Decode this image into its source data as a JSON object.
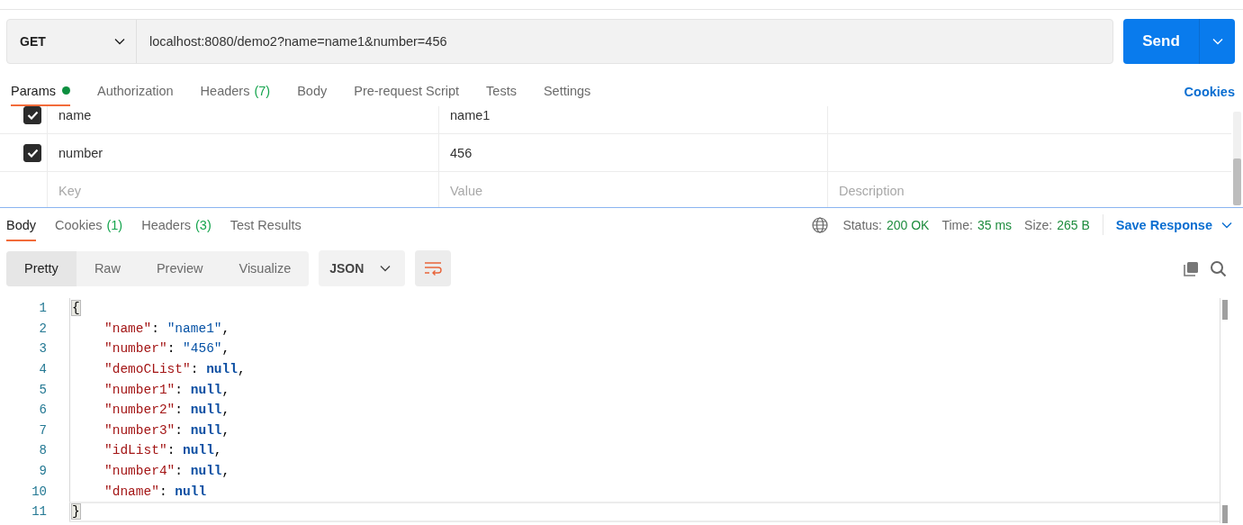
{
  "request": {
    "method": "GET",
    "url": "localhost:8080/demo2?name=name1&number=456",
    "send": "Send"
  },
  "request_tabs": [
    {
      "label": "Params",
      "indicator": true,
      "selected": true
    },
    {
      "label": "Authorization",
      "indicator": false,
      "selected": false
    },
    {
      "label": "Headers",
      "count": "(7)",
      "indicator": false,
      "selected": false
    },
    {
      "label": "Body",
      "indicator": false,
      "selected": false
    },
    {
      "label": "Pre-request Script",
      "indicator": false,
      "selected": false
    },
    {
      "label": "Tests",
      "indicator": false,
      "selected": false
    },
    {
      "label": "Settings",
      "indicator": false,
      "selected": false
    }
  ],
  "cookies_link": "Cookies",
  "params": {
    "rows": [
      {
        "key": "name",
        "value": "name1",
        "checked": true
      },
      {
        "key": "number",
        "value": "456",
        "checked": true
      }
    ],
    "new_row": {
      "key_placeholder": "Key",
      "value_placeholder": "Value",
      "description_placeholder": "Description"
    }
  },
  "response_tabs": [
    {
      "label": "Body",
      "selected": true
    },
    {
      "label": "Cookies",
      "count": "(1)",
      "selected": false
    },
    {
      "label": "Headers",
      "count": "(3)",
      "selected": false
    },
    {
      "label": "Test Results",
      "selected": false
    }
  ],
  "response_meta": [
    {
      "label": "Status:",
      "value": "200 OK"
    },
    {
      "label": "Time:",
      "value": "35 ms"
    },
    {
      "label": "Size:",
      "value": "265 B"
    }
  ],
  "save_response": "Save Response",
  "view_modes": [
    {
      "label": "Pretty",
      "selected": true
    },
    {
      "label": "Raw",
      "selected": false
    },
    {
      "label": "Preview",
      "selected": false
    },
    {
      "label": "Visualize",
      "selected": false
    }
  ],
  "format": "JSON",
  "wrap_on": true,
  "code_lines": [
    {
      "number": "1",
      "current": false,
      "tokens": [
        {
          "kind": "brace",
          "text": "{"
        }
      ],
      "children": [
        {
          "number": "2",
          "current": false,
          "tokens": [
            {
              "kind": "key",
              "text": "\"name\""
            },
            {
              "kind": "punct",
              "text": ": "
            },
            {
              "kind": "string",
              "text": "\"name1\""
            },
            {
              "kind": "punct",
              "text": ","
            }
          ]
        },
        {
          "number": "3",
          "current": false,
          "tokens": [
            {
              "kind": "key",
              "text": "\"number\""
            },
            {
              "kind": "punct",
              "text": ": "
            },
            {
              "kind": "string",
              "text": "\"456\""
            },
            {
              "kind": "punct",
              "text": ","
            }
          ]
        },
        {
          "number": "4",
          "current": false,
          "tokens": [
            {
              "kind": "key",
              "text": "\"demoCList\""
            },
            {
              "kind": "punct",
              "text": ": "
            },
            {
              "kind": "null",
              "text": "null"
            },
            {
              "kind": "punct",
              "text": ","
            }
          ]
        },
        {
          "number": "5",
          "current": false,
          "tokens": [
            {
              "kind": "key",
              "text": "\"number1\""
            },
            {
              "kind": "punct",
              "text": ": "
            },
            {
              "kind": "null",
              "text": "null"
            },
            {
              "kind": "punct",
              "text": ","
            }
          ]
        },
        {
          "number": "6",
          "current": false,
          "tokens": [
            {
              "kind": "key",
              "text": "\"number2\""
            },
            {
              "kind": "punct",
              "text": ": "
            },
            {
              "kind": "null",
              "text": "null"
            },
            {
              "kind": "punct",
              "text": ","
            }
          ]
        },
        {
          "number": "7",
          "current": false,
          "tokens": [
            {
              "kind": "key",
              "text": "\"number3\""
            },
            {
              "kind": "punct",
              "text": ": "
            },
            {
              "kind": "null",
              "text": "null"
            },
            {
              "kind": "punct",
              "text": ","
            }
          ]
        },
        {
          "number": "8",
          "current": false,
          "tokens": [
            {
              "kind": "key",
              "text": "\"idList\""
            },
            {
              "kind": "punct",
              "text": ": "
            },
            {
              "kind": "null",
              "text": "null"
            },
            {
              "kind": "punct",
              "text": ","
            }
          ]
        },
        {
          "number": "9",
          "current": false,
          "tokens": [
            {
              "kind": "key",
              "text": "\"number4\""
            },
            {
              "kind": "punct",
              "text": ": "
            },
            {
              "kind": "null",
              "text": "null"
            },
            {
              "kind": "punct",
              "text": ","
            }
          ]
        },
        {
          "number": "10",
          "current": false,
          "tokens": [
            {
              "kind": "key",
              "text": "\"dname\""
            },
            {
              "kind": "punct",
              "text": ": "
            },
            {
              "kind": "null",
              "text": "null"
            }
          ]
        }
      ]
    },
    {
      "number": "11",
      "current": true,
      "tokens": [
        {
          "kind": "brace",
          "text": "}"
        }
      ]
    }
  ]
}
